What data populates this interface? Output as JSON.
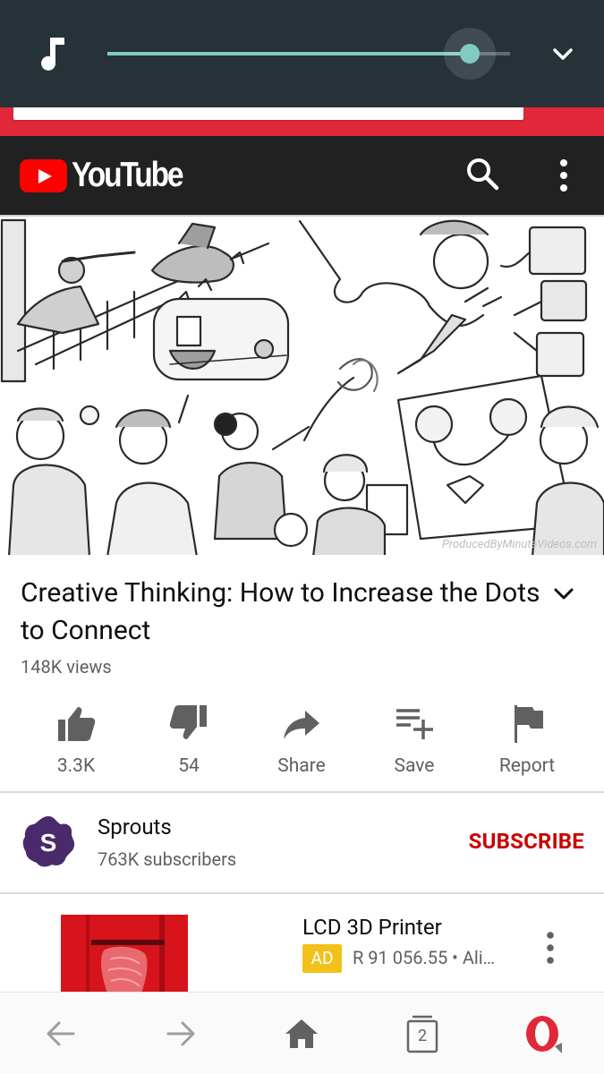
{
  "system": {
    "volume_percent": 90
  },
  "youtube": {
    "brand": "YouTube",
    "icons": [
      "search-icon",
      "more-vert-icon"
    ]
  },
  "thumbnail": {
    "watermark": "ProducedByMinuteVideos.com"
  },
  "video": {
    "title": "Creative Thinking: How to Increase the Dots to Connect",
    "views": "148K views"
  },
  "actions": [
    {
      "name": "like",
      "label": "3.3K",
      "icon": "thumb-up-icon"
    },
    {
      "name": "dislike",
      "label": "54",
      "icon": "thumb-down-icon"
    },
    {
      "name": "share",
      "label": "Share",
      "icon": "share-icon"
    },
    {
      "name": "save",
      "label": "Save",
      "icon": "playlist-add-icon"
    },
    {
      "name": "report",
      "label": "Report",
      "icon": "flag-icon"
    }
  ],
  "channel": {
    "name": "Sprouts",
    "subscribers": "763K subscribers",
    "subscribe_label": "SUBSCRIBE",
    "avatar_letter": "S"
  },
  "ad": {
    "title": "LCD 3D Printer",
    "badge": "AD",
    "meta": "R 91 056.55 • Ali…"
  },
  "browser_nav": {
    "tab_count": "2",
    "icons": [
      "back-icon",
      "forward-icon",
      "home-icon",
      "tabs-icon",
      "opera-icon"
    ]
  },
  "colors": {
    "status_bg": "#263238",
    "accent_teal": "#80cbc4",
    "youtube_red": "#ff0000",
    "subscribe_red": "#cc0000",
    "opera_red": "#e0283a",
    "ad_yellow": "#f2c21b"
  }
}
